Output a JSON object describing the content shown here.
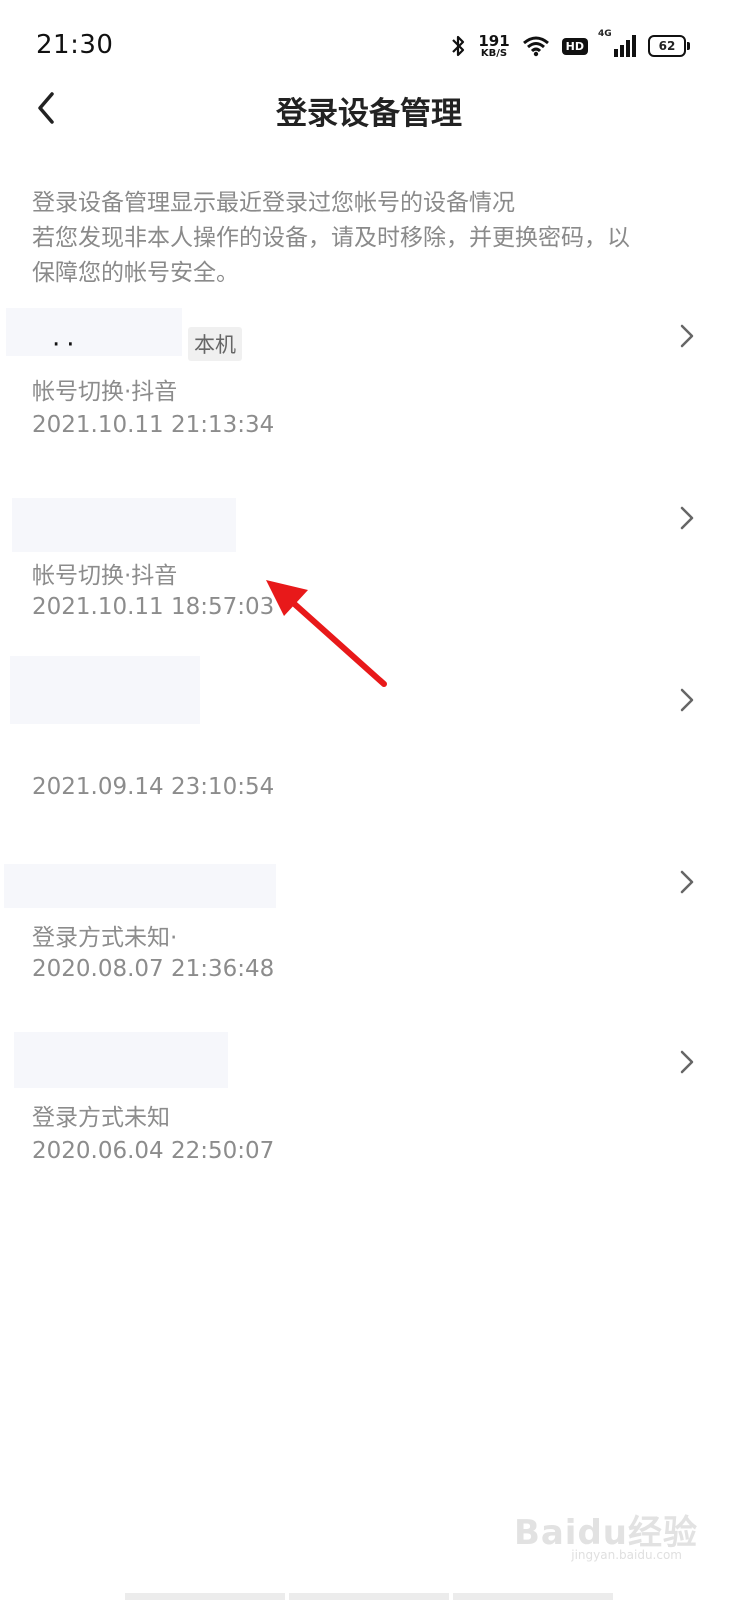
{
  "status": {
    "time": "21:30",
    "net_speed_value": "191",
    "net_speed_unit": "KB/S",
    "hd": "HD",
    "network": "4G",
    "battery": "62"
  },
  "header": {
    "title": "登录设备管理"
  },
  "description": {
    "line1": "登录设备管理显示最近登录过您帐号的设备情况",
    "line2": "若您发现非本人操作的设备，请及时移除，并更换密码，以",
    "line3": "保障您的帐号安全。"
  },
  "devices": [
    {
      "tag": "本机",
      "method": "帐号切换·抖音",
      "time": "2021.10.11 21:13:34"
    },
    {
      "method": "帐号切换·抖音",
      "time": "2021.10.11 18:57:03"
    },
    {
      "method": "",
      "time": "2021.09.14 23:10:54"
    },
    {
      "method": "登录方式未知·",
      "time": "2020.08.07 21:36:48"
    },
    {
      "method": "登录方式未知",
      "time": "2020.06.04 22:50:07"
    }
  ],
  "watermark": {
    "brand": "Baidu经验",
    "url": "jingyan.baidu.com"
  },
  "icons": {
    "back": "back-arrow-icon",
    "chevron": "chevron-right-icon",
    "bluetooth": "bluetooth-icon",
    "wifi": "wifi-icon"
  },
  "colors": {
    "annotation_arrow": "#e8191a",
    "muted_text": "#8c8c8c"
  }
}
